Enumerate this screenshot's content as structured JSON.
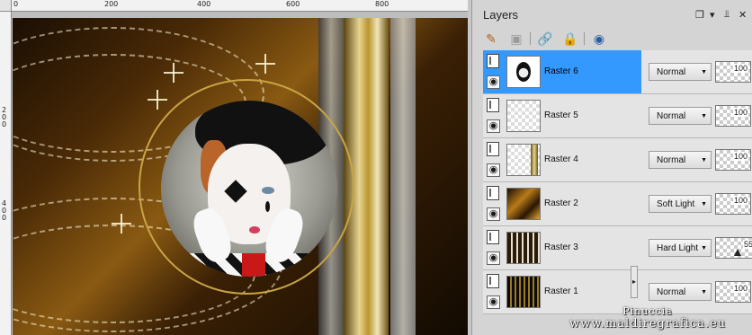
{
  "ruler": {
    "top_ticks": [
      "0",
      "200",
      "400",
      "600",
      "800"
    ],
    "left_ticks": [
      {
        "label": "2\n0\n0"
      },
      {
        "label": "4\n0\n0"
      }
    ]
  },
  "watermark": {
    "line1": "Pinuccia",
    "line2": "www.maldiregrafica.eu"
  },
  "panel": {
    "title": "Layers",
    "header_buttons": [
      "restore-icon",
      "dropdown-icon",
      "pin-icon",
      "close-icon"
    ]
  },
  "toolbar": {
    "icons": [
      "edit-layer-icon",
      "mask-icon",
      "link-icon",
      "lock-icon",
      "blend-palette-icon"
    ]
  },
  "layers": [
    {
      "name": "Raster 6",
      "blend": "Normal",
      "opacity": "100",
      "selected": true,
      "visible": true
    },
    {
      "name": "Raster 5",
      "blend": "Normal",
      "opacity": "100",
      "selected": false,
      "visible": true
    },
    {
      "name": "Raster 4",
      "blend": "Normal",
      "opacity": "100",
      "selected": false,
      "visible": true
    },
    {
      "name": "Raster 2",
      "blend": "Soft Light",
      "opacity": "100",
      "selected": false,
      "visible": true
    },
    {
      "name": "Raster 3",
      "blend": "Hard Light",
      "opacity": "55",
      "selected": false,
      "visible": true
    },
    {
      "name": "Raster 1",
      "blend": "Normal",
      "opacity": "100",
      "selected": false,
      "visible": true
    }
  ],
  "colors": {
    "selection": "#3399ff",
    "panel_bg": "#d4d4d4",
    "ring_gold": "#c9a444"
  }
}
